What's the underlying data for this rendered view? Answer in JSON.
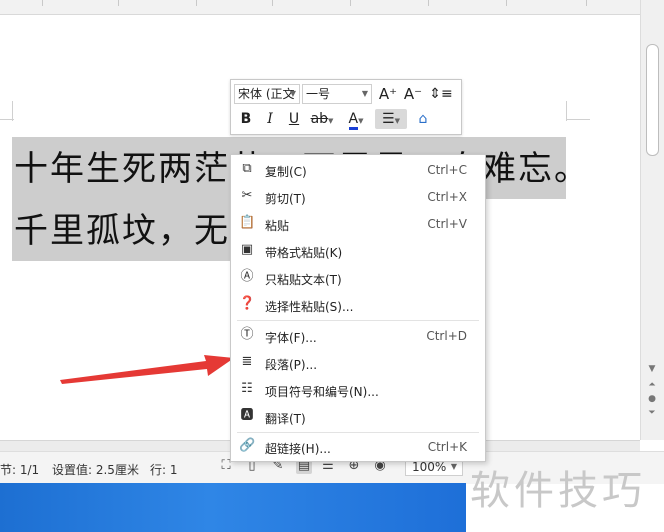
{
  "document": {
    "line1": "十年生死两茫茫，不思量，自难忘。",
    "line2": "千里孤坟，无处话凄凉。"
  },
  "mini_toolbar": {
    "font_name": "宋体 (正文",
    "font_size": "一号",
    "grow_font_label": "A⁺",
    "shrink_font_label": "A⁻",
    "bold_label": "B",
    "italic_label": "I",
    "underline_label": "U",
    "highlight_label": "ab",
    "font_color_label": "A"
  },
  "context_menu": {
    "items": [
      {
        "label": "复制(C)",
        "shortcut": "Ctrl+C",
        "icon": "copy-icon"
      },
      {
        "label": "剪切(T)",
        "shortcut": "Ctrl+X",
        "icon": "cut-icon"
      },
      {
        "label": "粘贴",
        "shortcut": "Ctrl+V",
        "icon": "paste-icon"
      },
      {
        "label": "带格式粘贴(K)",
        "shortcut": "",
        "icon": "paste-format-icon"
      },
      {
        "label": "只粘贴文本(T)",
        "shortcut": "",
        "icon": "paste-text-icon"
      },
      {
        "label": "选择性粘贴(S)...",
        "shortcut": "",
        "icon": "paste-special-icon"
      },
      {
        "label": "字体(F)...",
        "shortcut": "Ctrl+D",
        "icon": "font-icon"
      },
      {
        "label": "段落(P)...",
        "shortcut": "",
        "icon": "paragraph-icon"
      },
      {
        "label": "项目符号和编号(N)...",
        "shortcut": "",
        "icon": "bullets-icon"
      },
      {
        "label": "翻译(T)",
        "shortcut": "",
        "icon": "translate-icon"
      },
      {
        "label": "超链接(H)...",
        "shortcut": "Ctrl+K",
        "icon": "hyperlink-icon"
      }
    ]
  },
  "status_bar": {
    "section": "节: 1/1",
    "setting": "设置值: 2.5厘米",
    "row": "行: 1",
    "zoom": "100%"
  },
  "watermark": "软件技巧",
  "colors": {
    "selection": "#cdcdcd",
    "arrow": "#e53935",
    "taskbar": "#2f86e6",
    "font_color_underline": "#1a3fd6"
  }
}
